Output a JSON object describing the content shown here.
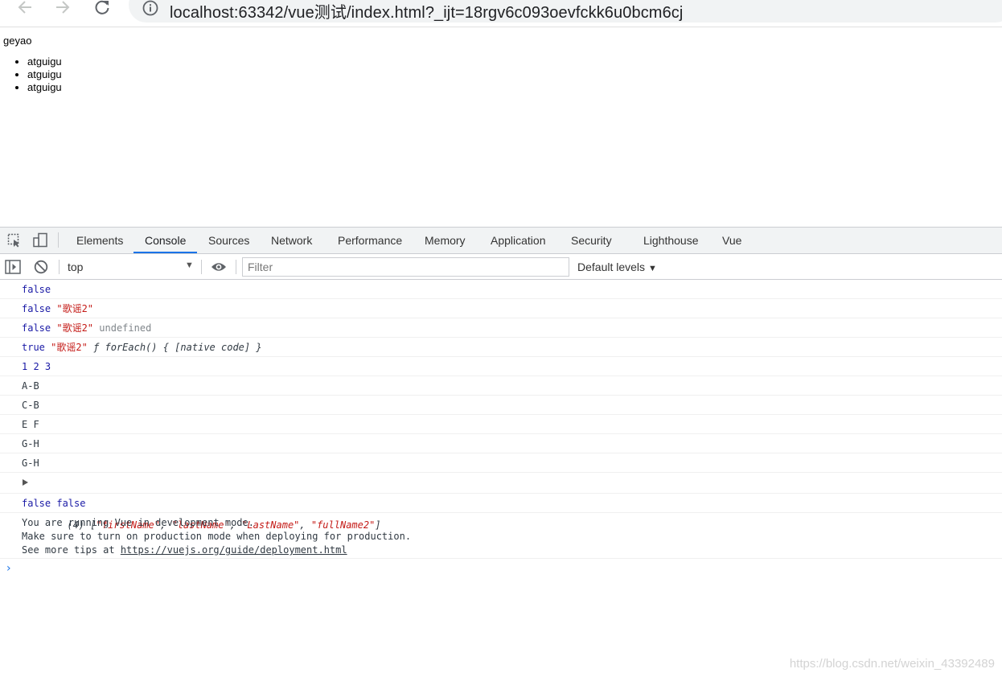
{
  "browser": {
    "url": "localhost:63342/vue测试/index.html?_ijt=18rgv6c093oevfckk6u0bcm6cj",
    "icons": [
      "back-arrow-icon",
      "forward-arrow-icon",
      "reload-icon",
      "info-icon"
    ]
  },
  "page": {
    "title": "geyao",
    "items": [
      "atguigu",
      "atguigu",
      "atguigu"
    ]
  },
  "devtools": {
    "tabs": [
      "Elements",
      "Console",
      "Sources",
      "Network",
      "Performance",
      "Memory",
      "Application",
      "Security",
      "Lighthouse",
      "Vue"
    ],
    "active_tab": "Console",
    "context": "top",
    "filter_placeholder": "Filter",
    "levels": "Default levels"
  },
  "console": {
    "row1": {
      "a": "false"
    },
    "row2": {
      "a": "false",
      "b": "\"歌谣2\""
    },
    "row3": {
      "a": "false",
      "b": "\"歌谣2\"",
      "c": "undefined"
    },
    "row4": {
      "a": "true",
      "b": "\"歌谣2\"",
      "c": "ƒ forEach() { [native code] }"
    },
    "row5": {
      "a": "1 2 3"
    },
    "row6": {
      "a": "A-B"
    },
    "row7": {
      "a": "C-B"
    },
    "row8": {
      "a": "E F"
    },
    "row9": {
      "a": "G-H"
    },
    "row10": {
      "a": "G-H"
    },
    "row11": {
      "count": "(4)",
      "open": "[",
      "items": [
        "\"firstName\"",
        "\"lastName\"",
        "\"LastName\"",
        "\"fullName2\""
      ],
      "close": "]"
    },
    "row12": {
      "a": "false false"
    },
    "vue_message": {
      "line1": "You are running Vue in development mode.",
      "line2": "Make sure to turn on production mode when deploying for production.",
      "line3_prefix": "See more tips at ",
      "link": "https://vuejs.org/guide/deployment.html"
    },
    "prompt": "›"
  },
  "watermark": "https://blog.csdn.net/weixin_43392489",
  "colors": {
    "keyword": "#1a1aa6",
    "string": "#c41a16",
    "muted": "#80868b",
    "accent": "#1a73e8"
  }
}
